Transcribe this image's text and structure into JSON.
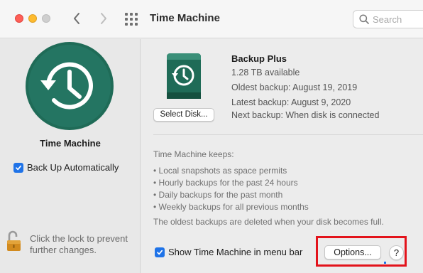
{
  "window": {
    "title": "Time Machine"
  },
  "search": {
    "placeholder": "Search"
  },
  "sidebar": {
    "app_name": "Time Machine",
    "back_up_automatically": {
      "label": "Back Up Automatically",
      "checked": true
    },
    "lock_text": "Click the lock to prevent further changes."
  },
  "disk": {
    "name": "Backup Plus",
    "available": "1.28 TB available",
    "oldest_backup": "Oldest backup: August 19, 2019",
    "latest_backup": "Latest backup: August 9, 2020",
    "next_backup": "Next backup: When disk is connected",
    "select_button": "Select Disk..."
  },
  "info": {
    "keeps_heading": "Time Machine keeps:",
    "bullets": [
      "• Local snapshots as space permits",
      "• Hourly backups for the past 24 hours",
      "• Daily backups for the past month",
      "• Weekly backups for all previous months"
    ],
    "oldest_note": "The oldest backups are deleted when your disk becomes full."
  },
  "footer": {
    "show_in_menu_bar": {
      "label": "Show Time Machine in menu bar",
      "checked": true
    },
    "options_button": "Options...",
    "help_button": "?"
  },
  "colors": {
    "accent": "#1f73e8",
    "highlight_box": "#e3131b",
    "tm_icon": "#1f6b57"
  }
}
